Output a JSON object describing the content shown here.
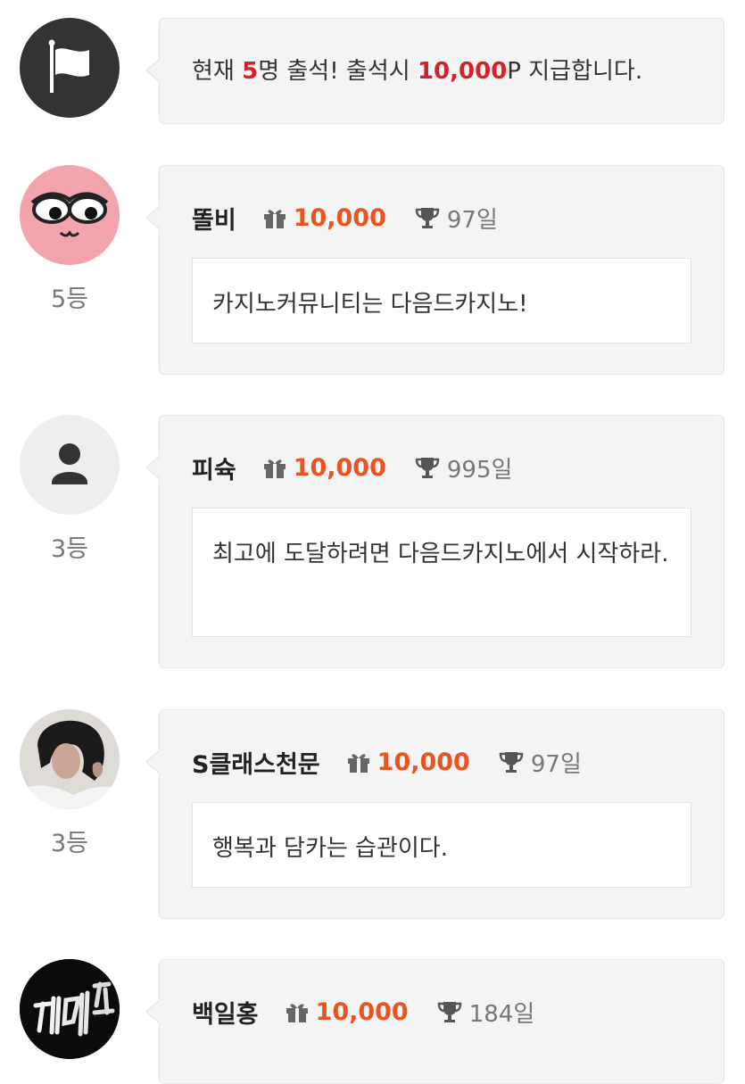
{
  "notice": {
    "icon": "flag-icon",
    "prefix": "현재 ",
    "count": "5",
    "middle": "명 출석! 출석시 ",
    "reward": "10,000",
    "suffix": "P 지급합니다."
  },
  "entries": [
    {
      "nickname": "똘비",
      "points": "10,000",
      "days": "97일",
      "rank": "5등",
      "message": "카지노커뮤니티는 다음드카지노!",
      "avatar": "emoji-face-avatar"
    },
    {
      "nickname": "피슉",
      "points": "10,000",
      "days": "995일",
      "rank": "3등",
      "message": "최고에 도달하려면 다음드카지노에서 시작하라.",
      "avatar": "default-user-avatar"
    },
    {
      "nickname": "S클래스천문",
      "points": "10,000",
      "days": "97일",
      "rank": "3등",
      "message": "행복과 담카는 습관이다.",
      "avatar": "photo-avatar"
    },
    {
      "nickname": "백일홍",
      "points": "10,000",
      "days": "184일",
      "rank": "",
      "message": "",
      "avatar": "neon-sign-avatar"
    }
  ],
  "icons": {
    "gift": "gift-icon",
    "trophy": "trophy-icon"
  },
  "colors": {
    "highlight": "#d2232a",
    "points": "#e8531f",
    "bubble": "#f4f4f4"
  }
}
